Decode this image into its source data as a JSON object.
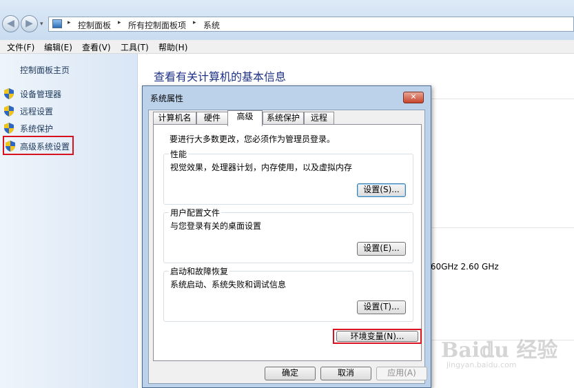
{
  "address_bar": {
    "crumbs": [
      "控制面板",
      "所有控制面板项",
      "系统"
    ],
    "arrow": "▸",
    "back_glyph": "◀",
    "forward_glyph": "▶",
    "recent_glyph": "▾",
    "icon": "control-panel-icon"
  },
  "menu": {
    "items": [
      "文件(F)",
      "编辑(E)",
      "查看(V)",
      "工具(T)",
      "帮助(H)"
    ]
  },
  "sidebar": {
    "home": "控制面板主页",
    "tasks": [
      {
        "label": "设备管理器",
        "icon": "uac-shield-icon"
      },
      {
        "label": "远程设置",
        "icon": "uac-shield-icon"
      },
      {
        "label": "系统保护",
        "icon": "uac-shield-icon"
      },
      {
        "label": "高级系统设置",
        "icon": "uac-shield-icon"
      }
    ]
  },
  "main": {
    "title": "查看有关计算机的基本信息",
    "cpu_speed": ".60GHz   2.60 GHz"
  },
  "dialog": {
    "title": "系统属性",
    "close_glyph": "✕",
    "tabs": [
      {
        "label": "计算机名",
        "active": false
      },
      {
        "label": "硬件",
        "active": false
      },
      {
        "label": "高级",
        "active": true
      },
      {
        "label": "系统保护",
        "active": false
      },
      {
        "label": "远程",
        "active": false
      }
    ],
    "admin_note": "要进行大多数更改，您必须作为管理员登录。",
    "groups": [
      {
        "title": "性能",
        "description": "视觉效果，处理器计划，内存使用，以及虚拟内存",
        "button": "设置(S)..."
      },
      {
        "title": "用户配置文件",
        "description": "与您登录有关的桌面设置",
        "button": "设置(E)..."
      },
      {
        "title": "启动和故障恢复",
        "description": "系统启动、系统失败和调试信息",
        "button": "设置(T)..."
      }
    ],
    "env_button": "环境变量(N)...",
    "ok": "确定",
    "cancel": "取消",
    "apply": "应用(A)"
  },
  "watermark": {
    "brand": "Bai𝕕u 经验",
    "url": "jingyan.baidu.com"
  },
  "colors": {
    "highlight_red": "#d8111e",
    "link_blue": "#1e395b",
    "title_blue": "#1e3287"
  }
}
